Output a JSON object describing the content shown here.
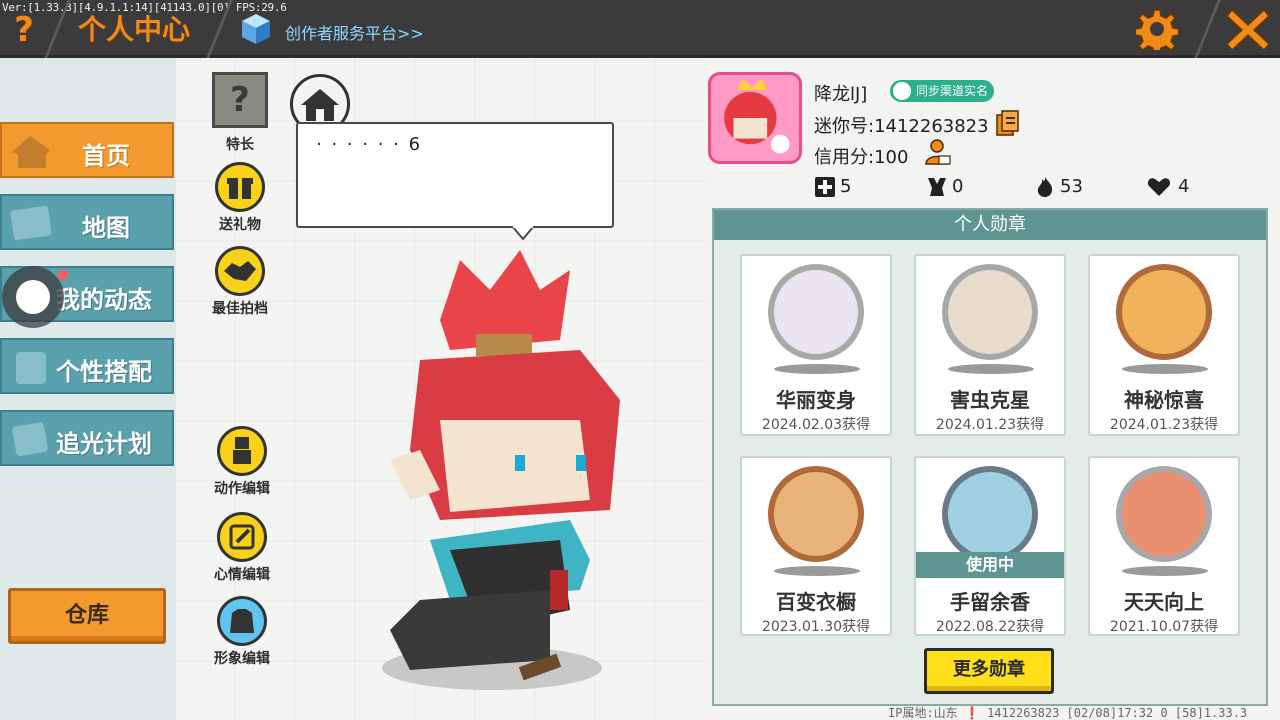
{
  "topbar": {
    "version_text": "Ver:[1.33.3][4.9.1.1:14][41143.0][0] FPS:29.6",
    "title": "个人中心",
    "creator_link": "创作者服务平台>>",
    "help_symbol": "?",
    "icons": [
      "help-icon",
      "cube-icon",
      "gear-icon",
      "close-icon"
    ],
    "accent_color": "#f28a1a"
  },
  "nav": {
    "items": [
      {
        "label": "首页",
        "icon": "house-icon",
        "active": true
      },
      {
        "label": "地图",
        "icon": "map-icon",
        "active": false
      },
      {
        "label": "我的动态",
        "icon": "feed-icon",
        "active": false
      },
      {
        "label": "个性搭配",
        "icon": "outfit-icon",
        "active": false
      },
      {
        "label": "追光计划",
        "icon": "light-plan-icon",
        "active": false
      }
    ],
    "warehouse_label": "仓库"
  },
  "stage": {
    "specialty_label": "特长",
    "specialty_symbol": "?",
    "gift_label": "送礼物",
    "best_partner_label": "最佳拍档",
    "action_edit_label": "动作编辑",
    "mood_edit_label": "心情编辑",
    "appearance_edit_label": "形象编辑",
    "speech_text": "· · · · · · 6"
  },
  "user": {
    "nickname": "降龙lJ]",
    "realname_badge": "同步渠道实名",
    "mini_id": "迷你号:1412263823",
    "credit": "信用分:100",
    "stats": [
      {
        "icon": "plus-box-icon",
        "value": "5"
      },
      {
        "icon": "trophy-person-icon",
        "value": "0"
      },
      {
        "icon": "flame-icon",
        "value": "53"
      },
      {
        "icon": "hearts-icon",
        "value": "4"
      }
    ]
  },
  "medals": {
    "header": "个人勋章",
    "items": [
      {
        "name": "华丽变身",
        "date": "2024.02.03获得",
        "in_use": false,
        "color": "#e9e4ef"
      },
      {
        "name": "害虫克星",
        "date": "2024.01.23获得",
        "in_use": false,
        "color": "#e7dccd"
      },
      {
        "name": "神秘惊喜",
        "date": "2024.01.23获得",
        "in_use": false,
        "color": "#f1b25c"
      },
      {
        "name": "百变衣橱",
        "date": "2023.01.30获得",
        "in_use": false,
        "color": "#e8b47a"
      },
      {
        "name": "手留余香",
        "date": "2022.08.22获得",
        "in_use": true,
        "color": "#9fd1e3"
      },
      {
        "name": "天天向上",
        "date": "2021.10.07获得",
        "in_use": false,
        "color": "#ea8f70"
      }
    ],
    "in_use_label": "使用中",
    "more_label": "更多勋章"
  },
  "footer": {
    "text": "IP属地:山东 ❗   1412263823   [02/08]17:32 0   [58]1.33.3"
  }
}
